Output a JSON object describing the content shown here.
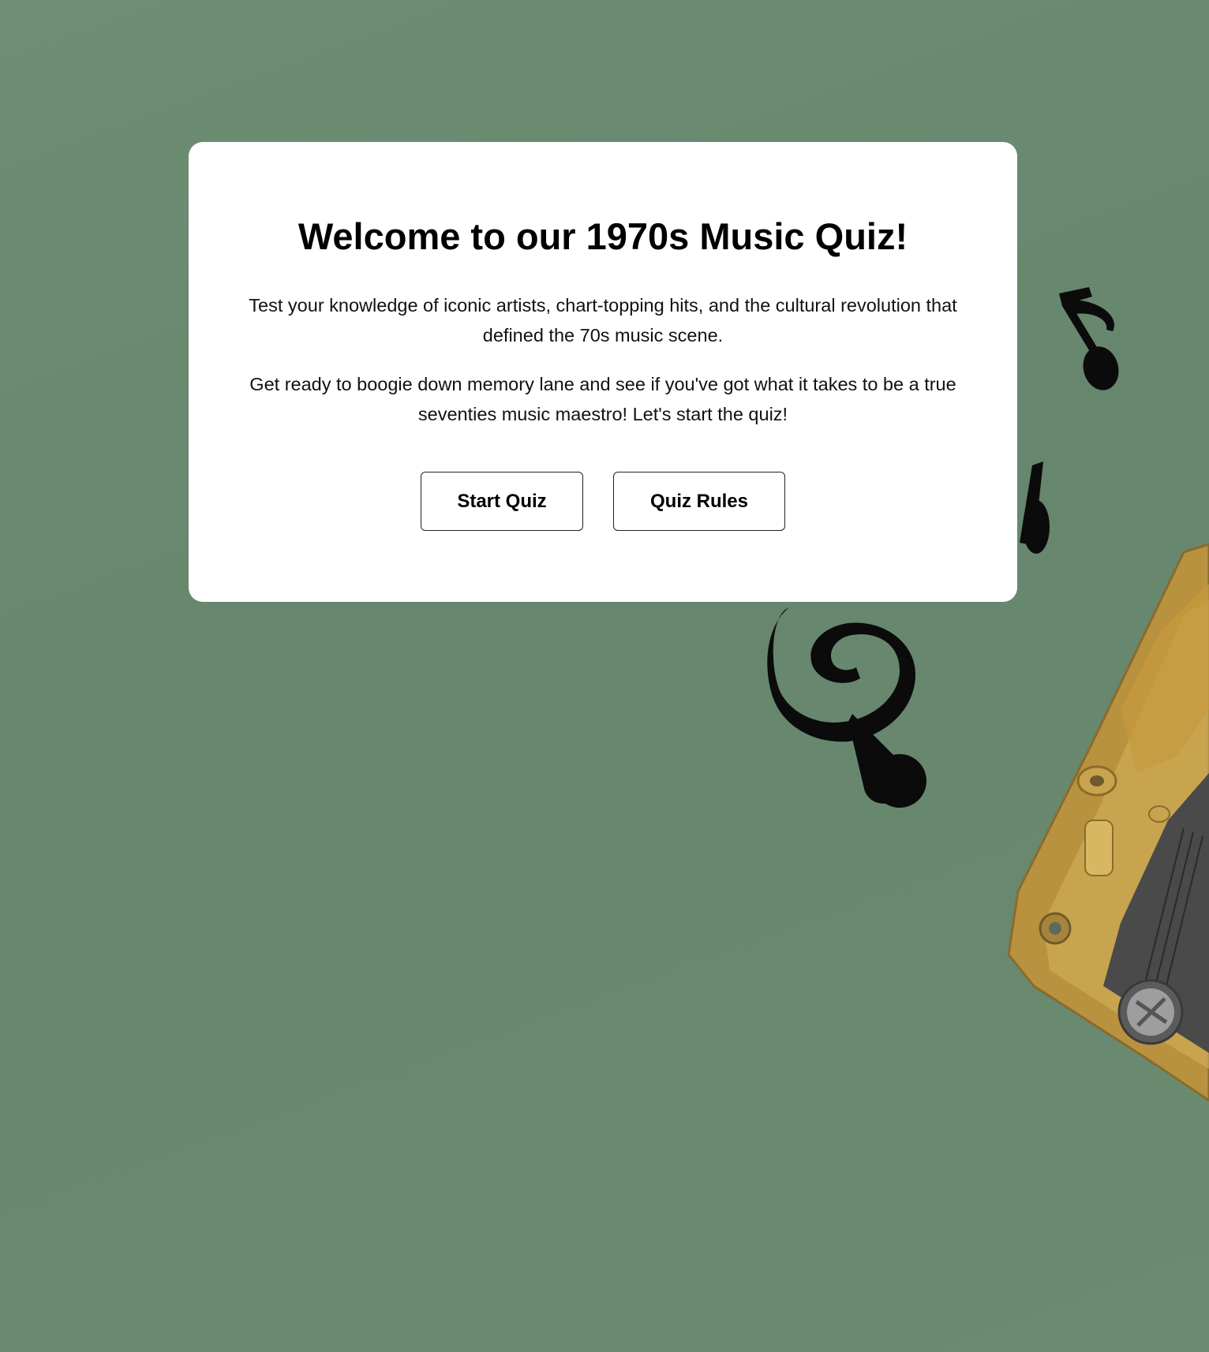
{
  "welcome": {
    "title": "Welcome to our 1970s Music Quiz!",
    "intro": "Test your knowledge of iconic artists, chart-topping hits, and the cultural revolution that defined the 70s music scene.",
    "invite": "Get ready to boogie down memory lane and see if you've got what it takes to be a true seventies music maestro! Let's start the quiz!"
  },
  "actions": {
    "start_label": "Start Quiz",
    "rules_label": "Quiz Rules"
  },
  "decorations": {
    "icons": [
      "eighth-note-icon",
      "eighth-note-icon",
      "treble-clef-icon",
      "music-box-mechanism"
    ]
  },
  "colors": {
    "background": "#6a8a70",
    "card": "#ffffff",
    "text": "#000000",
    "gold": "#c9a44e"
  }
}
